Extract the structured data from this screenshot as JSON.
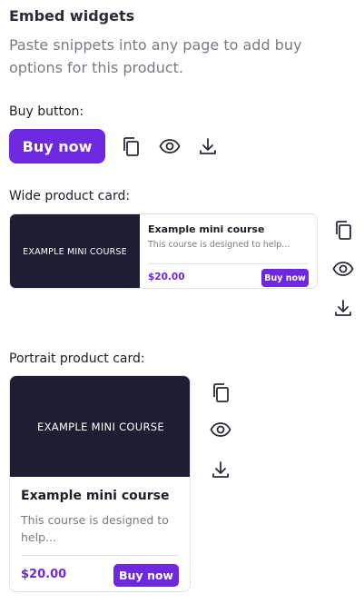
{
  "header": {
    "title": "Embed widgets",
    "description": "Paste snippets into any page to add buy options for this product."
  },
  "colors": {
    "accent": "#6d28e0",
    "thumbnail_bg": "#1e1e33",
    "muted_text": "#7a7a85"
  },
  "buy_button_section": {
    "label": "Buy button:",
    "button_label": "Buy now",
    "icons": [
      "copy-icon",
      "eye-icon",
      "download-icon"
    ]
  },
  "wide_card_section": {
    "label": "Wide product card:",
    "thumbnail_text": "EXAMPLE MINI COURSE",
    "product_title": "Example mini course",
    "product_description": "This course is designed to help...",
    "price": "$20.00",
    "buy_label": "Buy now",
    "icons": [
      "copy-icon",
      "eye-icon",
      "download-icon"
    ]
  },
  "portrait_card_section": {
    "label": "Portrait product card:",
    "thumbnail_text": "EXAMPLE MINI COURSE",
    "product_title": "Example mini course",
    "product_description": "This course is designed to help...",
    "price": "$20.00",
    "buy_label": "Buy now",
    "icons": [
      "copy-icon",
      "eye-icon",
      "download-icon"
    ]
  }
}
